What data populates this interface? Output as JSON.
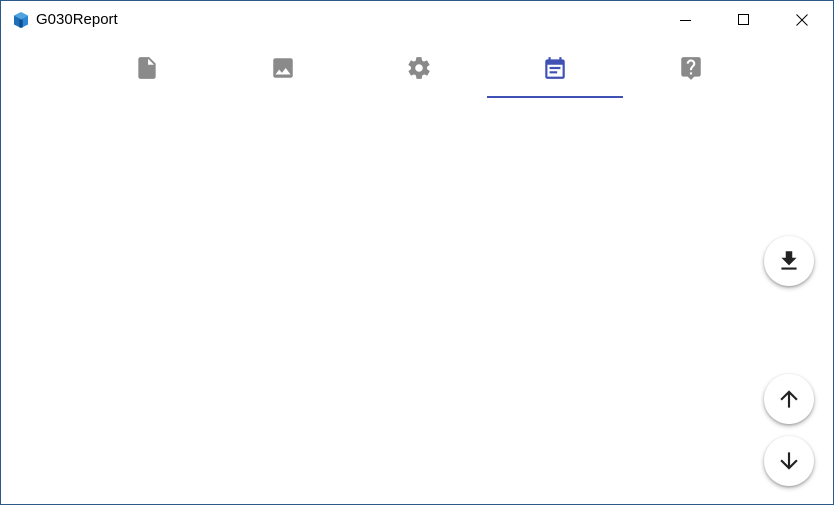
{
  "window": {
    "title": "G030Report",
    "app_icon": "app-cube-icon",
    "controls": [
      "minimize-icon",
      "maximize-icon",
      "close-icon"
    ]
  },
  "tabs": [
    {
      "icon": "file-icon",
      "selected": false
    },
    {
      "icon": "image-icon",
      "selected": false
    },
    {
      "icon": "settings-gear-icon",
      "selected": false
    },
    {
      "icon": "calendar-icon",
      "selected": true
    },
    {
      "icon": "help-icon",
      "selected": false
    }
  ],
  "colors": {
    "accent": "#3f51b5",
    "inactive_icon": "#8a8a8a",
    "fab_icon": "#222222"
  },
  "fabs": [
    {
      "icon": "download-icon"
    },
    {
      "icon": "arrow-up-icon"
    },
    {
      "icon": "arrow-down-icon"
    }
  ]
}
